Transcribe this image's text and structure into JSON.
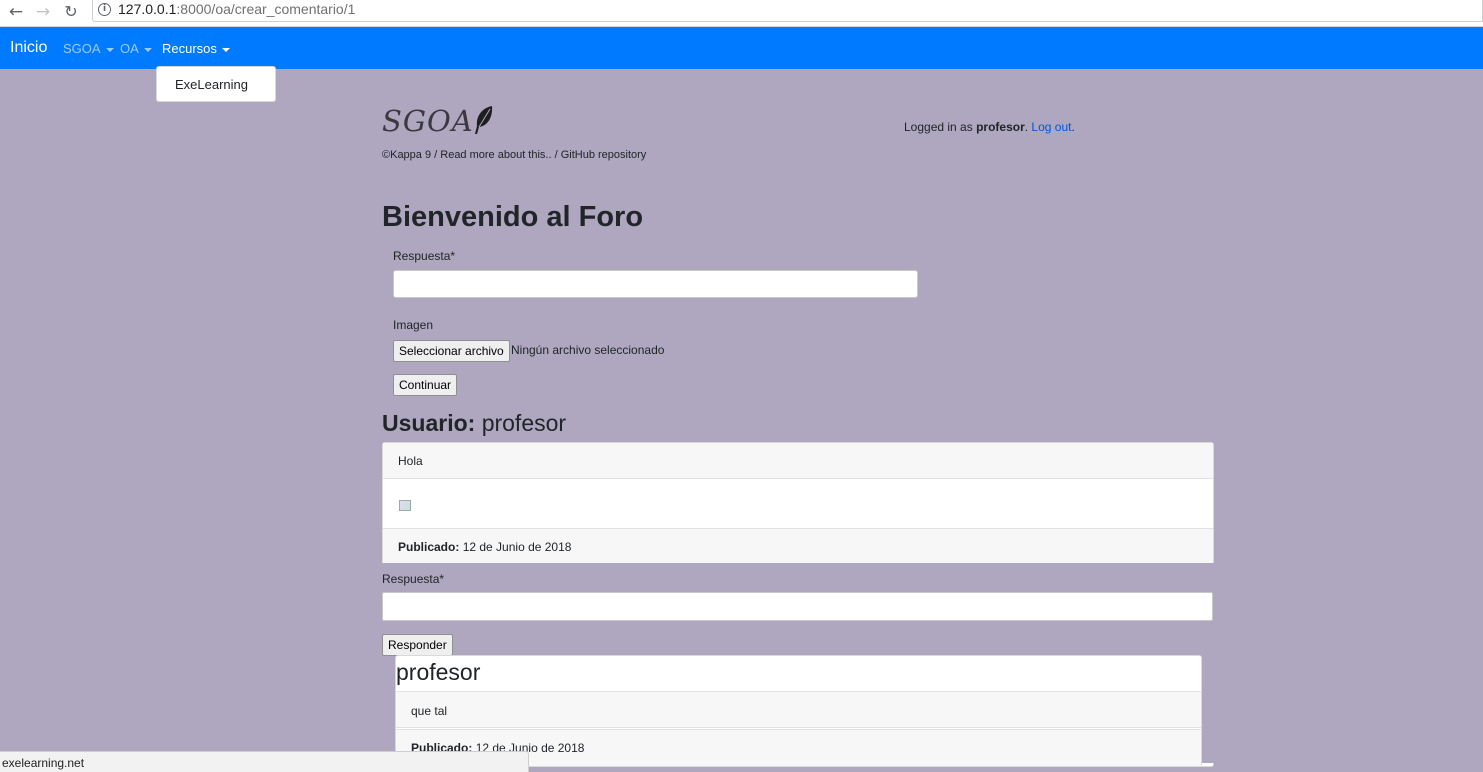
{
  "browser": {
    "url_host": "127.0.0.1",
    "url_rest": ":8000/oa/crear_comentario/1",
    "status_text": "exelearning.net"
  },
  "navbar": {
    "brand": "Inicio",
    "items": [
      {
        "label": "SGOA"
      },
      {
        "label": "OA"
      },
      {
        "label": "Recursos"
      }
    ],
    "dropdown_items": [
      {
        "label": "ExeLearning"
      }
    ]
  },
  "header": {
    "logo_text": "SGOA",
    "footer_links": "©Kappa 9 / Read more about this.. / GitHub repository",
    "login_prefix": "Logged in as ",
    "login_user": "profesor",
    "logout_label": "Log out",
    "login_period": "."
  },
  "main": {
    "title": "Bienvenido al Foro",
    "response_label": "Respuesta*",
    "image_label": "Imagen",
    "file_button": "Seleccionar archivo",
    "file_status": "Ningún archivo seleccionado",
    "continue_button": "Continuar",
    "user_label": "Usuario:",
    "user_name": "profesor"
  },
  "comment": {
    "text": "Hola",
    "published_label": "Publicado:",
    "published_date": "12 de Junio de 2018",
    "reply_label": "Respuesta*",
    "reply_button": "Responder"
  },
  "reply": {
    "author": "profesor",
    "text": "que tal",
    "published_label": "Publicado:",
    "published_date": "12 de Junio de 2018"
  },
  "colors": {
    "navbar": "#007bff",
    "background": "#aea7bf",
    "link": "#0056d6"
  }
}
